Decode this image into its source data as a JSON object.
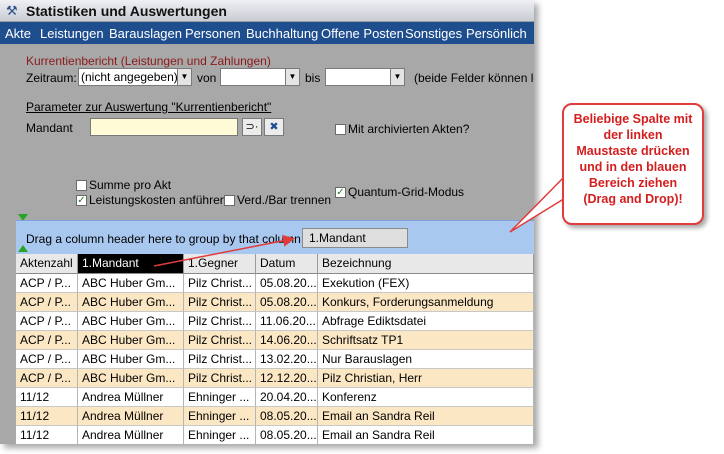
{
  "window": {
    "title": "Statistiken und Auswertungen"
  },
  "menu": [
    "Akte",
    "Leistungen",
    "Barauslagen",
    "Personen",
    "Buchhaltung",
    "Offene Posten",
    "Sonstiges",
    "Persönlich"
  ],
  "form": {
    "section_title": "Kurrentienbericht (Leistungen und Zahlungen)",
    "zeitraum_label": "Zeitraum:",
    "zeitraum_value": "(nicht angegeben)",
    "von_label": "von",
    "bis_label": "bis",
    "hint": "(beide Felder können le",
    "param_title": "Parameter zur Auswertung \"Kurrentienbericht\"",
    "mandant_label": "Mandant",
    "mandant_value": "",
    "archived_label": "Mit archivierten Akten?",
    "summe_label": "Summe pro Akt",
    "leistungskosten_label": "Leistungskosten anführen",
    "verd_label": "Verd./Bar trennen",
    "quantum_label": "Quantum-Grid-Modus"
  },
  "checkboxes": {
    "archived": false,
    "summe": false,
    "leistungskosten": true,
    "verd": false,
    "quantum": true
  },
  "grid": {
    "group_hint": "Drag a column header here to group by that column",
    "drag_chip": "1.Mandant",
    "columns": [
      "Aktenzahl",
      "1.Mandant",
      "1.Gegner",
      "Datum",
      "Bezeichnung"
    ],
    "rows": [
      [
        "ACP / P...",
        "ABC Huber Gm...",
        "Pilz Christ...",
        "05.08.20...",
        "Exekution (FEX)"
      ],
      [
        "ACP / P...",
        "ABC Huber Gm...",
        "Pilz Christ...",
        "05.08.20...",
        "Konkurs, Forderungsanmeldung"
      ],
      [
        "ACP / P...",
        "ABC Huber Gm...",
        "Pilz Christ...",
        "11.06.20...",
        "Abfrage Ediktsdatei"
      ],
      [
        "ACP / P...",
        "ABC Huber Gm...",
        "Pilz Christ...",
        "14.06.20...",
        "Schriftsatz TP1"
      ],
      [
        "ACP / P...",
        "ABC Huber Gm...",
        "Pilz Christ...",
        "13.02.20...",
        "Nur Barauslagen"
      ],
      [
        "ACP / P...",
        "ABC Huber Gm...",
        "Pilz Christ...",
        "12.12.20...",
        "Pilz Christian, Herr"
      ],
      [
        "11/12",
        "Andrea Müllner",
        "Ehninger ...",
        "20.04.20...",
        "Konferenz"
      ],
      [
        "11/12",
        "Andrea Müllner",
        "Ehninger ...",
        "08.05.20...",
        "Email an Sandra Reil"
      ],
      [
        "11/12",
        "Andrea Müllner",
        "Ehninger ...",
        "08.05.20...",
        "Email an Sandra Reil"
      ]
    ]
  },
  "callout": {
    "lines": [
      "Beliebige Spalte mit",
      "der linken",
      "Maustaste drücken",
      "und in den blauen",
      "Bereich ziehen",
      "(Drag and Drop)!"
    ]
  },
  "icons": {
    "title": "tool-icon",
    "browse": "browse-icon",
    "clear": "clear-x-icon",
    "dropdown": "chevron-down-icon"
  },
  "colors": {
    "menubar": "#1f4e8f",
    "group_panel": "#a9c8f0",
    "row_alt": "#fbe7c4",
    "callout": "#e23b3b"
  }
}
